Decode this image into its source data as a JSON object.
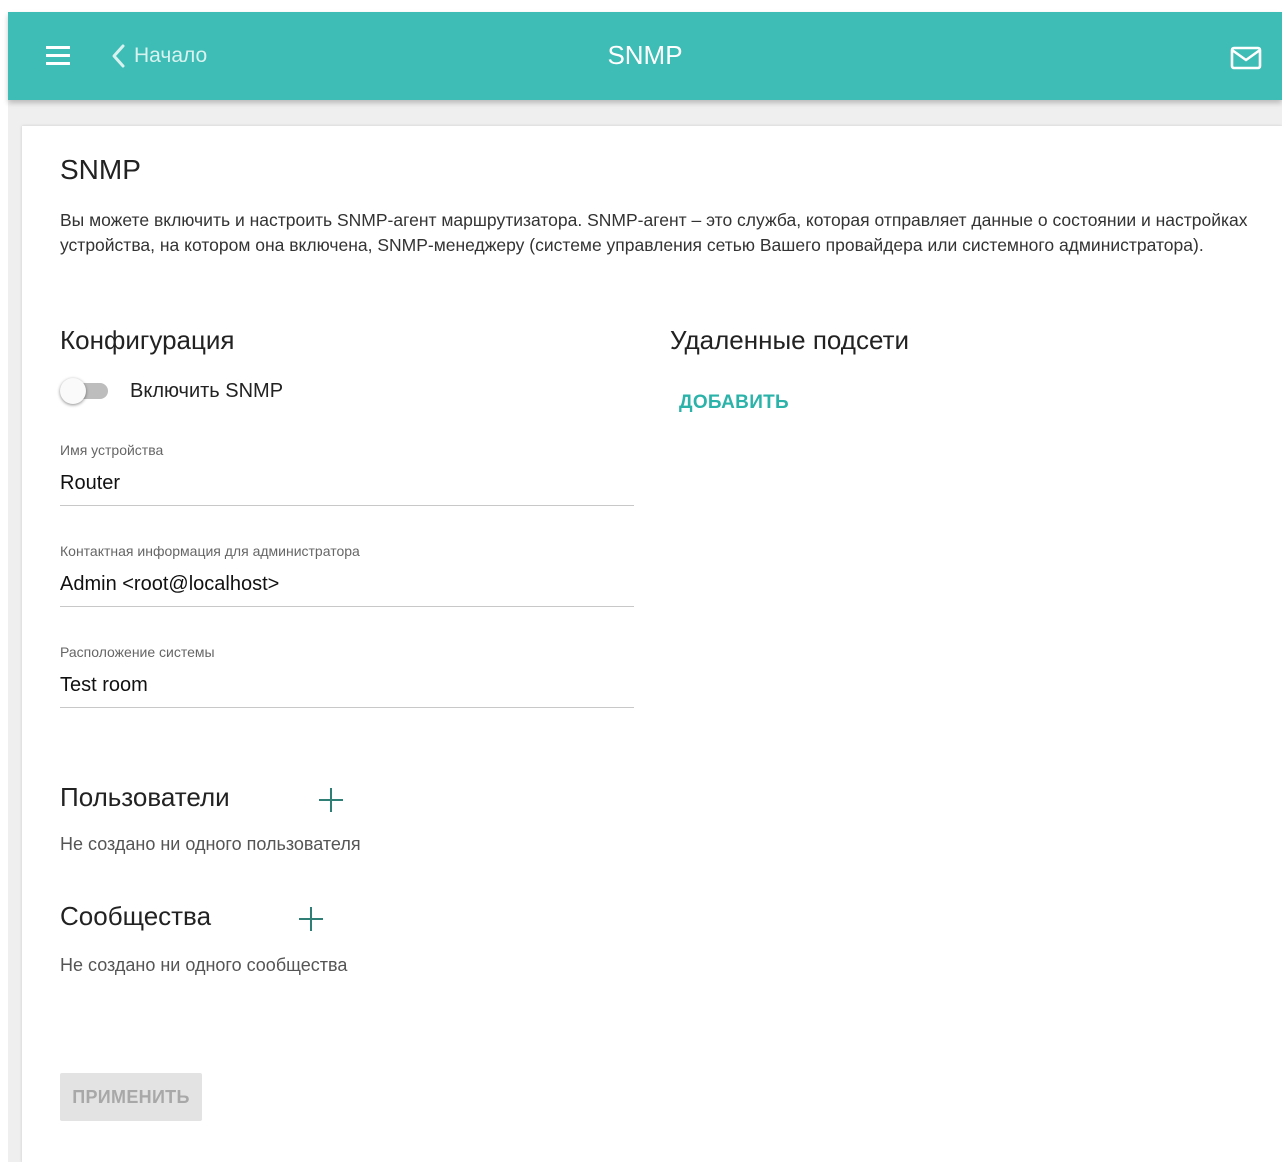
{
  "header": {
    "back_label": "Начало",
    "title": "SNMP",
    "menu_icon": "hamburger-menu-icon",
    "back_icon": "chevron-left-icon",
    "mail_icon": "mail-icon",
    "color": "#3dbdb5"
  },
  "snmp": {
    "title": "SNMP",
    "description": "Вы можете включить и настроить SNMP-агент маршрутизатора. SNMP-агент – это служба, которая отправляет данные о состоянии и настройках устройства, на котором она включена, SNMP-менеджеру (системе управления сетью Вашего провайдера или системного администратора)."
  },
  "config": {
    "title": "Конфигурация",
    "enable_label": "Включить SNMP",
    "enabled": false,
    "device_name_label": "Имя устройства",
    "device_name_value": "Router",
    "contact_label": "Контактная информация для администратора",
    "contact_value": "Admin <root@localhost>",
    "location_label": "Расположение системы",
    "location_value": "Test room"
  },
  "subnets": {
    "title": "Удаленные подсети",
    "add_label": "ДОБАВИТЬ"
  },
  "users": {
    "title": "Пользователи",
    "empty_text": "Не создано ни одного пользователя",
    "add_icon": "plus-icon"
  },
  "communities": {
    "title": "Сообщества",
    "empty_text": "Не создано ни одного сообщества",
    "add_icon": "plus-icon"
  },
  "apply_label": "ПРИМЕНИТЬ"
}
